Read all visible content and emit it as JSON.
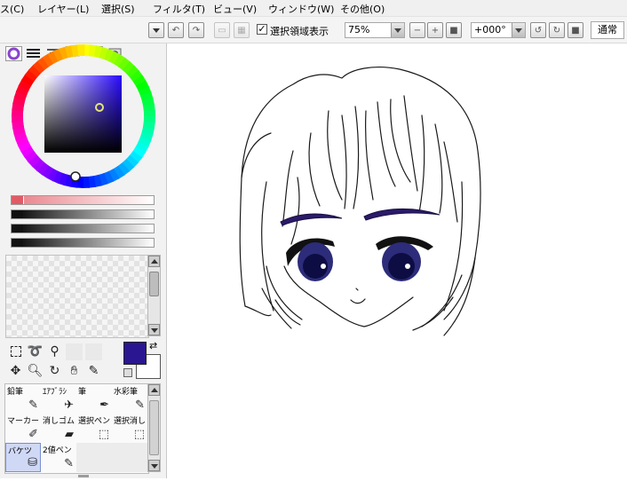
{
  "menu": [
    {
      "label": "ス(C)"
    },
    {
      "label": "レイヤー(L)"
    },
    {
      "label": "選択(S)"
    },
    {
      "label": "フィルタ(T)"
    },
    {
      "label": "ビュー(V)"
    },
    {
      "label": "ウィンドウ(W)"
    },
    {
      "label": "その他(O)"
    }
  ],
  "toolbar": {
    "show_selection_label": "選択領域表示",
    "show_selection_checked": true,
    "zoom_value": "75%",
    "rotation_value": "+000°",
    "blend_mode": "通常"
  },
  "colors": {
    "primary": "#2a1690",
    "secondary": "#ffffff",
    "eye": "#2c2c7a",
    "brow": "#2b1a6b"
  },
  "tools": [
    {
      "label": "鉛筆",
      "icon": "pencil-icon"
    },
    {
      "label": "ｴｱﾌﾞﾗｼ",
      "icon": "airbrush-icon"
    },
    {
      "label": "筆",
      "icon": "brush-icon"
    },
    {
      "label": "水彩筆",
      "icon": "watercolor-icon"
    },
    {
      "label": "マーカー",
      "icon": "marker-icon"
    },
    {
      "label": "消しゴム",
      "icon": "eraser-icon"
    },
    {
      "label": "選択ペン",
      "icon": "select-pen-icon"
    },
    {
      "label": "選択消し",
      "icon": "select-erase-icon"
    },
    {
      "label": "バケツ",
      "icon": "bucket-icon"
    },
    {
      "label": "2値ペン",
      "icon": "binary-pen-icon"
    }
  ]
}
